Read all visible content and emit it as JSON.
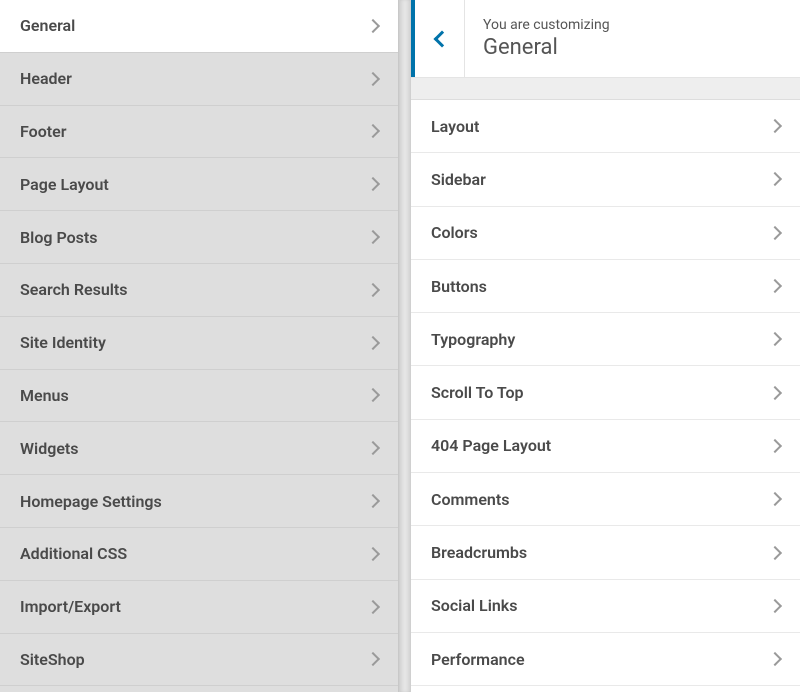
{
  "left_panel": {
    "items": [
      {
        "label": "General",
        "active": true
      },
      {
        "label": "Header",
        "active": false
      },
      {
        "label": "Footer",
        "active": false
      },
      {
        "label": "Page Layout",
        "active": false
      },
      {
        "label": "Blog Posts",
        "active": false
      },
      {
        "label": "Search Results",
        "active": false
      },
      {
        "label": "Site Identity",
        "active": false
      },
      {
        "label": "Menus",
        "active": false
      },
      {
        "label": "Widgets",
        "active": false
      },
      {
        "label": "Homepage Settings",
        "active": false
      },
      {
        "label": "Additional CSS",
        "active": false
      },
      {
        "label": "Import/Export",
        "active": false
      },
      {
        "label": "SiteShop",
        "active": false
      }
    ]
  },
  "right_panel": {
    "header": {
      "supertitle": "You are customizing",
      "title": "General"
    },
    "items": [
      {
        "label": "Layout"
      },
      {
        "label": "Sidebar"
      },
      {
        "label": "Colors"
      },
      {
        "label": "Buttons"
      },
      {
        "label": "Typography"
      },
      {
        "label": "Scroll To Top"
      },
      {
        "label": "404 Page Layout"
      },
      {
        "label": "Comments"
      },
      {
        "label": "Breadcrumbs"
      },
      {
        "label": "Social Links"
      },
      {
        "label": "Performance"
      }
    ]
  }
}
